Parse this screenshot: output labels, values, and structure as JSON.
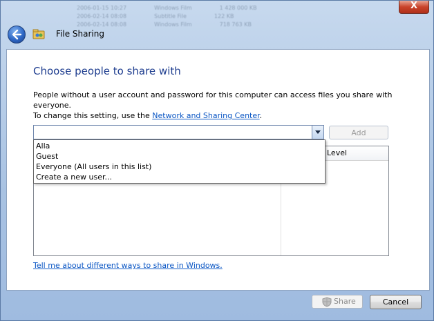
{
  "window": {
    "title": "File Sharing",
    "close_glyph": "X"
  },
  "main": {
    "heading": "Choose people to share with",
    "description_line1": "People without a user account and password for this computer can access files you share with everyone.",
    "description_line2_prefix": "To change this setting, use the ",
    "description_link": "Network and Sharing Center",
    "description_line2_suffix": ".",
    "people_input": {
      "value": "",
      "placeholder": ""
    },
    "add_label": "Add",
    "list_column_level": "Level",
    "dropdown_options": [
      "Alla",
      "Guest",
      "Everyone (All users in this list)",
      "Create a new user..."
    ],
    "help_link": "Tell me about different ways to share in Windows."
  },
  "footer": {
    "share_label": "Share",
    "cancel_label": "Cancel"
  },
  "icons": {
    "back": "back-arrow-icon",
    "app": "file-sharing-icon",
    "combo_arrow": "chevron-down-icon",
    "shield": "uac-shield-icon"
  },
  "colors": {
    "heading": "#1e3d8f",
    "link": "#0a56c4",
    "close": "#c9432b",
    "back": "#2f68c6"
  }
}
